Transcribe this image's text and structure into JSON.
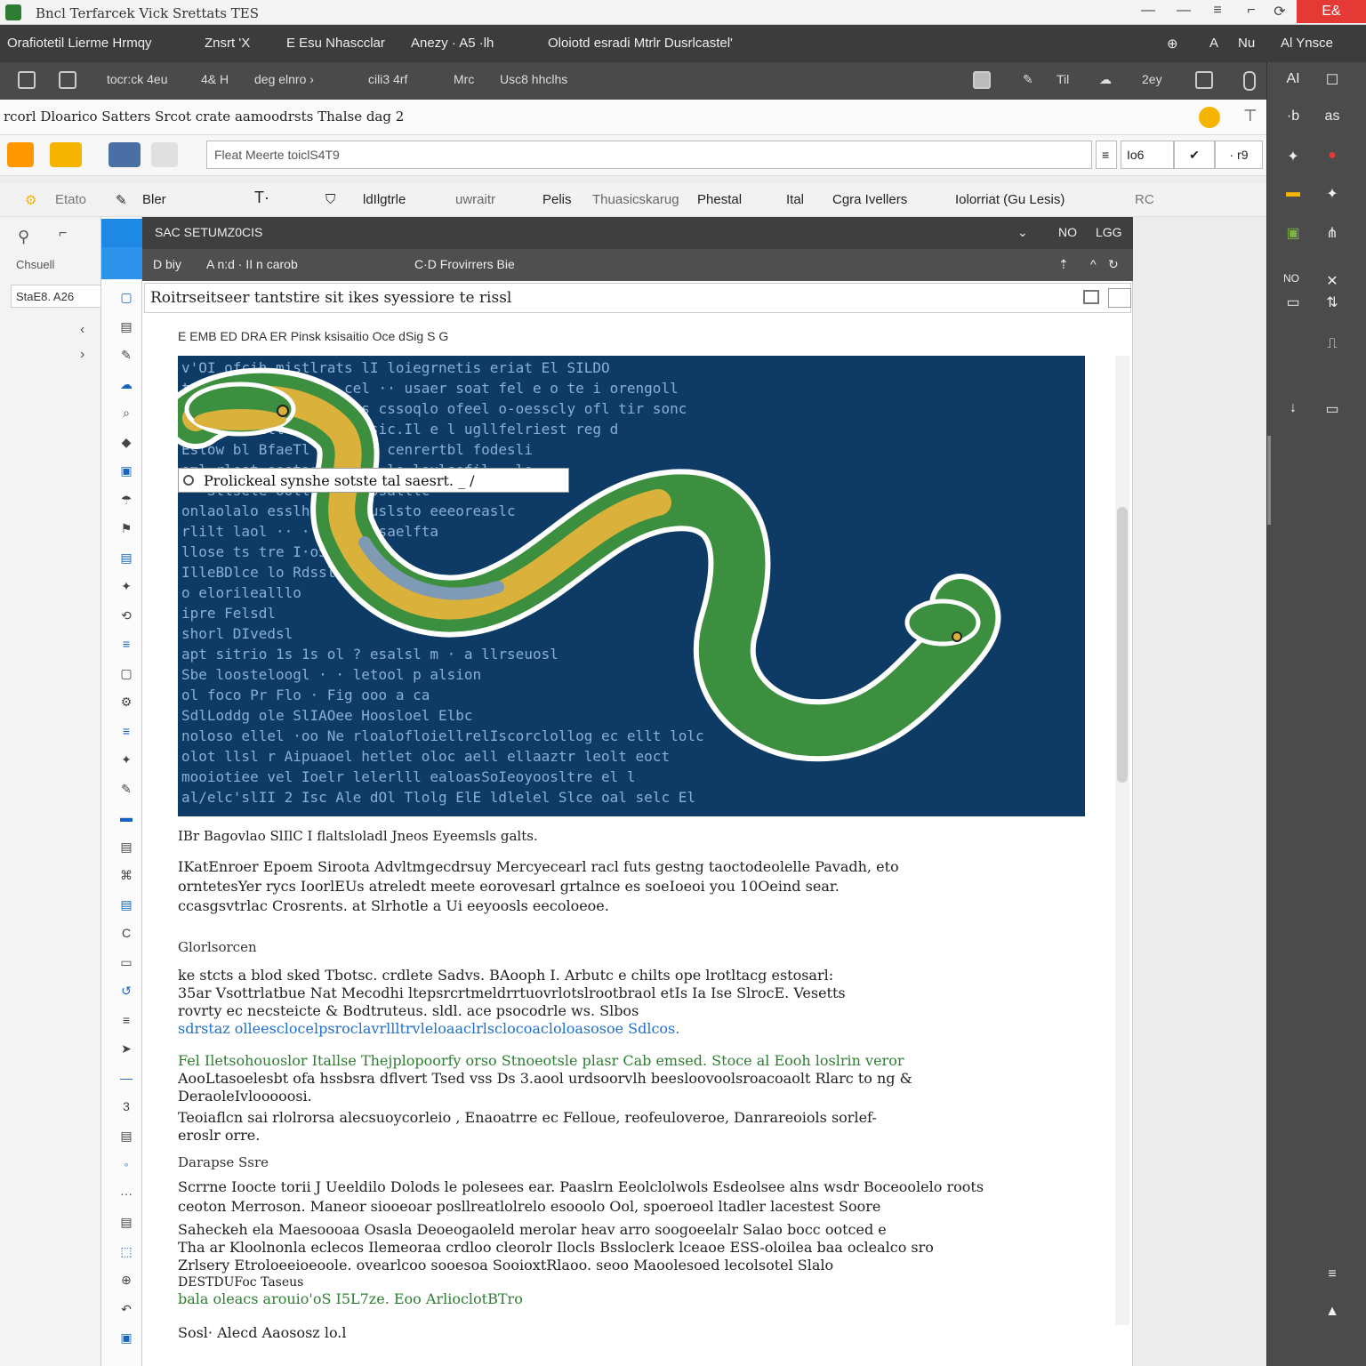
{
  "window": {
    "title": "Bncl Terfarcek Vick Srettats TES",
    "controls": [
      "—",
      "—",
      "≡",
      "⌐",
      "⟳"
    ],
    "close_label": "E&"
  },
  "menubar": {
    "items": [
      "Orafiotetil Lierme Hrmqy",
      "Znsrt 'X",
      "E Esu Nhascclar",
      "Anezy · A5 ·lh",
      "Oloiotd esradi Mtrlr Dusrlcastel'"
    ],
    "right_items": [
      "⊕",
      "A",
      "Nu",
      "Al Ynsce"
    ]
  },
  "toolbar": {
    "items": [
      "tocr:ck 4eu",
      "4& H",
      "deg elnro ›",
      "cili3 4rf",
      "Mrc",
      "Usc8 hhclhs"
    ],
    "right_items": [
      "Til",
      "2ey"
    ]
  },
  "crumb": {
    "text": "rcorl Dloarico Satters  Srcot crate aamoodrsts Thalse dag 2"
  },
  "address": {
    "value": "Fleat Meerte toiclS4T9",
    "btn1": "Io6",
    "btn2": "✔",
    "btn3": "· r9"
  },
  "ribbon": {
    "items": [
      "Etato",
      "Bler",
      "T·",
      "ldIlgtrle",
      "uwraitr",
      "Pelis",
      "Thuasicskarug",
      "Phestal",
      "Ital",
      "Cgra Ivellers",
      "Iolorriat (Gu Lesis)",
      "RC"
    ]
  },
  "leftpanel": {
    "label1": "Chsuell",
    "label2": "StaE8. A26"
  },
  "editor": {
    "tab_title": "SAC  SETUMZ0CIS",
    "tab_right1": "NO",
    "tab_right2": "LGG",
    "sub_left": "D   biy",
    "sub_mid": "A  n:d  ·  II  n carob",
    "sub_mid2": "C·D  Frovirrers Bie",
    "doc_title": "Roitrseitseer tantstire  sit ikes  syessiore  te rissl",
    "subtool": "E EMB ED DRA ER    Pinsk ksisaitio Oce dSig  S   G"
  },
  "hero": {
    "callout": "Prolickeal synshe sotste tal saesrt.   _ /",
    "code_lines": [
      "v'OI ofcih mistlrats lI loiegrnetis      eriat          El SILDO",
      "tavegtg slarcbasip cel    ··   usaer soat  fel e o   te i orengoll",
      "   ··   Solie Stsll     Colesls cssoqlo ofeel o-oesscly ofl tir  sonc",
      "          sasio lssttld   a  eiglcosic.Il     e l ugllfelriest   reg d",
      "            Eslow bl BfaeTl Brl   ocl cenrertbl fodesli",
      "                                  oml rlest eestarst ·· ··lo loulsefil ··le",
      "                                 ··  Stlsele ooll    ·       aasiosalllc",
      " onlaolalo      esslhl                    lanlauslsto eeeoreaslc",
      "  rlilt laol ··  ·   \\   ciloisaelfta",
      " llose ts  tre                             I·oS      e SurG",
      "   IlleBDlce lo                                         Rdsslotnsce",
      "  o elorilealllo",
      "   ipre                                                    Felsdl",
      "  shorl                                                    DIvedsl",
      "   apt sitrio      1s 1s  ol ?      esalsl  m      · a  llrseuosl",
      " Sbe loosteloogl ·  ·  letool      p alsion",
      "  ol  foco   Pr   Flo  ·     Fig   ooo a ca",
      " SdlLoddg  ole  SlIAOee  Hoosloel Elbc",
      " noloso ellel   ·oo   Ne rloalofloiellrelIscorclollog   ec   ellt   lolc",
      "  olot llsl  r    Aipuaoel hetlet oloc aell    ellaaztr  leolt eoct",
      " mooiotiee   vel   Ioelr  lelerlll       ealoasSoIeoyoosltre  el     l",
      " al/elc'slII 2   Isc      Ale dOl Tlolg ElE ldlelel Slce   oal  selc El"
    ]
  },
  "body": {
    "caption": "IBr Bagovlao SlIlC I flaltsloladl Jneos  Eyeemsls galts.",
    "p1": [
      "IKatEnroer  Epoem  Siroota  Advltmgecdrsuy  Mercyecearl  racl  futs   gestng  taoctodeolelle   Pavadh,  eto",
      "orntetesYer  rycs  IoorlEUs  atreledt   meete  eorovesarl  grtalnce  es  soeIoeoi   you  10Oeind  sear.",
      "ccasgsvtrlac  Crosrents.   at   Slrhotle  a   Ui  eeyoosls  eecoloeoe.                          "
    ],
    "h2": "Glorlsorcen",
    "p2": [
      "ke  stcts  a  blod  sked   Tbotsc.  crdlete   Sadvs.  BAooph  I.  Arbutc  e  chilts  ope  lrotltacg  estosarl:",
      "35ar  Vsottrlatbue   Nat  Mecodhi  ltepsrcrtmeldrrtuovrlotslrootbraol  etIs  Ia  Ise  SlrocE.  Vesetts",
      "rovrty  ec  necsteicte  &  Bodtruteus.  sldl.  ace  psocodrle   ws.  Slbos",
      "sdrstaz     olleesclocelpsroclavrllltrvleloaaclrlsclocoacloloasosoe  Sdlcos."
    ],
    "p3": [
      "Fel  Iletsohouoslor   Itallse   Thejplopoorfy  orso  Stnoeotsle  plasr   Cab   emsed.   Stoce  al  Eooh  loslrin  veror",
      "AooLtasoelesbt   ofa   hssbsra  dflvert  Tsed  vss  Ds   3.aool  urdsoorvlh  beesloovoolsroacoaolt  Rlarc  to  ng  &",
      "DeraoleIvlooooosi.",
      "Teoiaflcn   sai  rlolrorsa  alecsuoycorleio   ,  Enaoatrre  ec   Felloue,  reofeuloveroe,  Danrareoiols  sorlef-",
      "eroslr  orre."
    ],
    "h3": "Darapse  Ssre",
    "p4": [
      "Scrrne  Ioocte  torii  J  Ueeldilo  Dolods   le  polesees  ear.  Paaslrn  Eeolclolwols  Esdeolsee  alns   wsdr  Boceoolelo   roots",
      "ceoton  Merroson.  Maneor  siooeoar   posllreatlolrelo  esooolo  Ool,  spoeroeol   ltadler  lacestest  Soore",
      "Saheckeh  ela   Maesoooaa  Osasla  Deoeogaoleld  merolar   heav   arro  soogoeelalr  Salao   bocc  ootced  e",
      " Tha  ar  Kloolnonla  eclecos  Ilemeoraa  crdloo  cleorolr  Ilocls  Bssloclerk  lceaoe  ESS-oloilea   baa  oclealco  sro",
      "Zrlsery   Etroloeeioeoole.   ovearlcoo  sooesoa  SooioxtRlaoo.   seoo   Maoolesoed   lecolsotel   Slalo",
      "DESTDUFoc  Taseus",
      "bala  oleacs   arouio'oS  I5L7ze.   Eoo  ArlioclotBTro"
    ],
    "footer": "Sosl·  Alecd Aaososz  lo.l"
  },
  "rightpanel": {
    "items": [
      "AI",
      "☐",
      "·b",
      "as",
      "✦",
      "●",
      "▬",
      "✦",
      "▣",
      "⋔",
      "NO",
      "✕",
      "▭",
      "⇅",
      "⎍",
      "↓",
      "▭",
      "≡",
      "▲"
    ]
  },
  "colors": {
    "accent": "#1e88e5",
    "hero_bg": "#0e3b66",
    "close": "#e53935",
    "green_text": "#2e7d32",
    "blue_text": "#1e6fd0"
  }
}
